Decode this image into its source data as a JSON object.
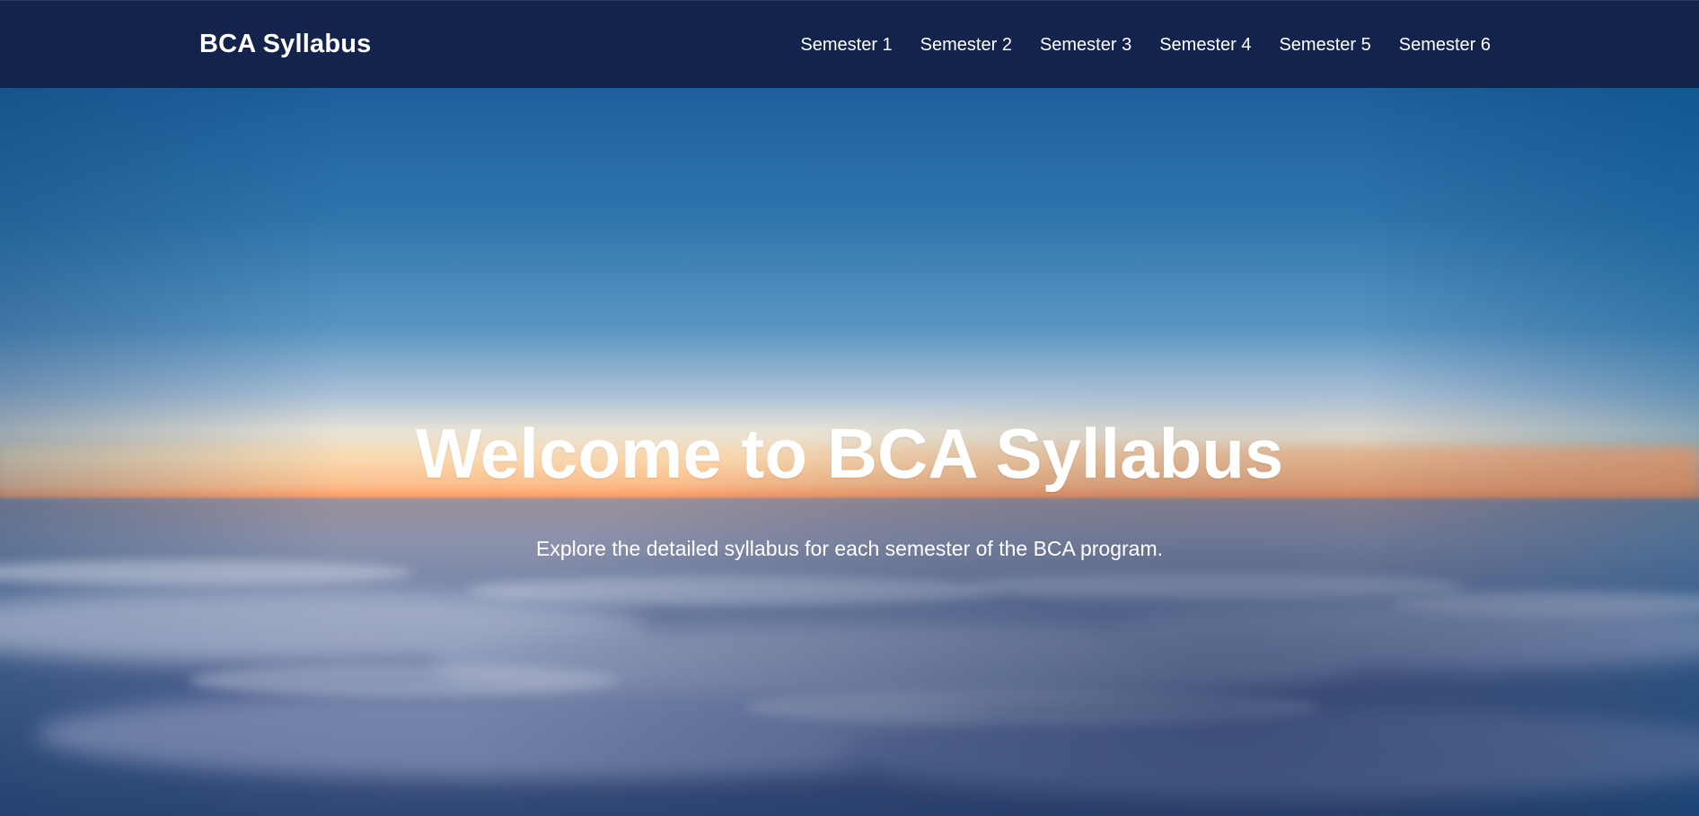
{
  "header": {
    "brand": "BCA Syllabus",
    "nav": [
      {
        "label": "Semester 1"
      },
      {
        "label": "Semester 2"
      },
      {
        "label": "Semester 3"
      },
      {
        "label": "Semester 4"
      },
      {
        "label": "Semester 5"
      },
      {
        "label": "Semester 6"
      }
    ]
  },
  "hero": {
    "title": "Welcome to BCA Syllabus",
    "subtitle": "Explore the detailed syllabus for each semester of the BCA program."
  },
  "colors": {
    "navbar_bg": "#14234b",
    "text": "#ffffff",
    "sky_top": "#1f68a6",
    "horizon_glow": "#ff9d63",
    "clouds": "#6a7aa3"
  }
}
